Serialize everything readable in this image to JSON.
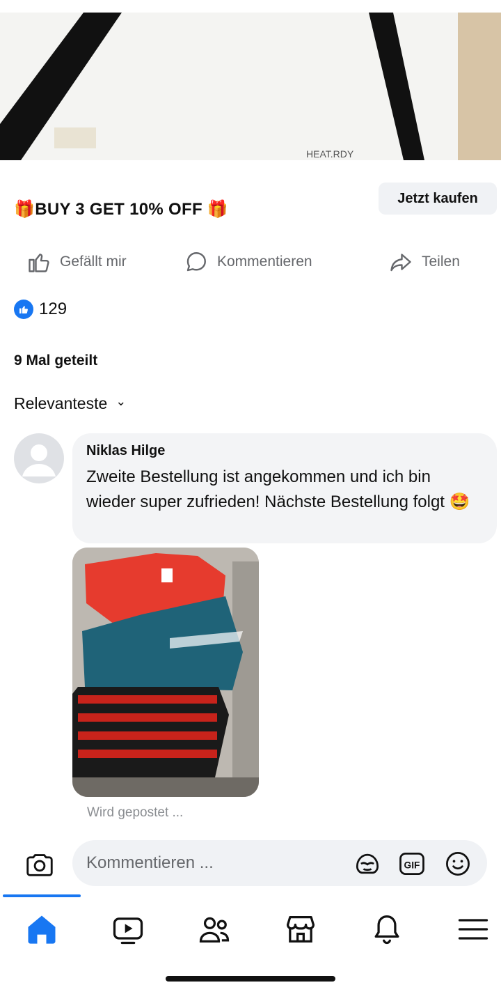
{
  "product_image": {
    "caption": "HEAT.RDY"
  },
  "promo": {
    "gift_emoji": "🎁",
    "text": "BUY 3 GET 10% OFF",
    "button_label": "Jetzt kaufen"
  },
  "actions": {
    "like_label": "Gefällt mir",
    "comment_label": "Kommentieren",
    "share_label": "Teilen"
  },
  "reactions": {
    "count": "129"
  },
  "shares": {
    "text": "9 Mal geteilt"
  },
  "sort": {
    "label": "Relevanteste",
    "chevron": "⌄"
  },
  "comment": {
    "author": "Niklas Hilge",
    "text": "Zweite Bestellung ist angekommen und ich bin wieder super zufrieden! Nächste Bestellung folgt 🤩",
    "status": "Wird gepostet ..."
  },
  "composer": {
    "placeholder": "Kommentieren ...",
    "gif_label": "GIF"
  },
  "colors": {
    "accent": "#1877f2",
    "icon_gray": "#65676b",
    "bubble_bg": "#f3f4f6"
  }
}
